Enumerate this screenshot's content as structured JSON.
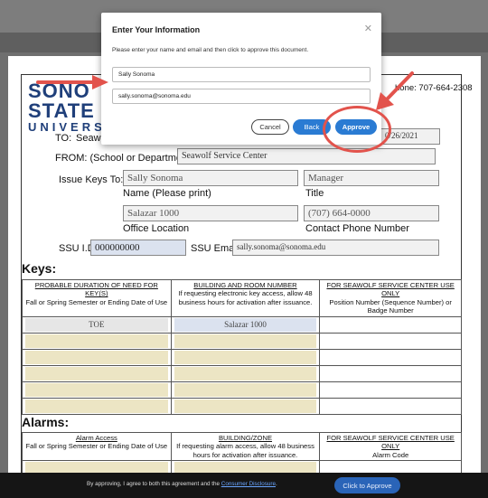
{
  "modal": {
    "title": "Enter Your Information",
    "description": "Please enter your name and email and then click to approve this document.",
    "name_value": "Sally Sonoma",
    "email_value": "sally.sonoma@sonoma.edu",
    "cancel_label": "Cancel",
    "back_label": "Back",
    "approve_label": "Approve"
  },
  "logo": {
    "line1": "SONO",
    "line2": "STATE",
    "line3": "UNIVERS"
  },
  "form": {
    "to_label": "TO:",
    "to_value": "Seaw",
    "phone_partial": "hone: 707-664-2308",
    "date_partial": "0/26/2021",
    "from_label": "FROM: (School or Department)",
    "from_value": "Seawolf Service Center",
    "issue_label": "Issue Keys To:",
    "name_value": "Sally Sonoma",
    "name_caption": "Name (Please print)",
    "title_value": "Manager",
    "title_caption": "Title",
    "office_value": "Salazar 1000",
    "office_caption": "Office Location",
    "phone_value": "(707) 664-0000",
    "phone_caption": "Contact Phone Number",
    "ssuid_label": "SSU I.D.",
    "ssuid_value": "000000000",
    "email_label": "SSU Email",
    "email_value": "sally.sonoma@sonoma.edu"
  },
  "keys": {
    "heading": "Keys:",
    "col1_title": "PROBABLE DURATION OF NEED FOR KEY(S)",
    "col1_sub": "Fall or Spring Semester or Ending Date of Use",
    "col2_title": "BUILDING AND ROOM NUMBER",
    "col2_sub": "If requesting electronic key access, allow 48 business hours for activation after issuance.",
    "col3_title": "FOR SEAWOLF SERVICE CENTER USE ONLY",
    "col3_sub": "Position Number (Sequence Number) or Badge Number",
    "row1_col1": "TOE",
    "row1_col2": "Salazar 1000"
  },
  "alarms": {
    "heading": "Alarms:",
    "col1_title": "Alarm Access",
    "col1_sub": "Fall or Spring Semester or Ending Date of Use",
    "col2_title": "BUILDING/ZONE",
    "col2_sub": "If requesting alarm access, allow 48 business hours for activation after issuance.",
    "col3_title": "FOR SEAWOLF SERVICE CENTER USE ONLY",
    "col3_sub": "Alarm Code"
  },
  "footer": {
    "agree_text": "By approving, I agree to both this agreement and the ",
    "disclosure_link": "Consumer Disclosure",
    "period": ".",
    "click_approve_label": "Click to Approve"
  },
  "colors": {
    "accent_blue": "#2a7bd3",
    "annotation_red": "#e2534c",
    "field_tan": "#ece5c4"
  }
}
